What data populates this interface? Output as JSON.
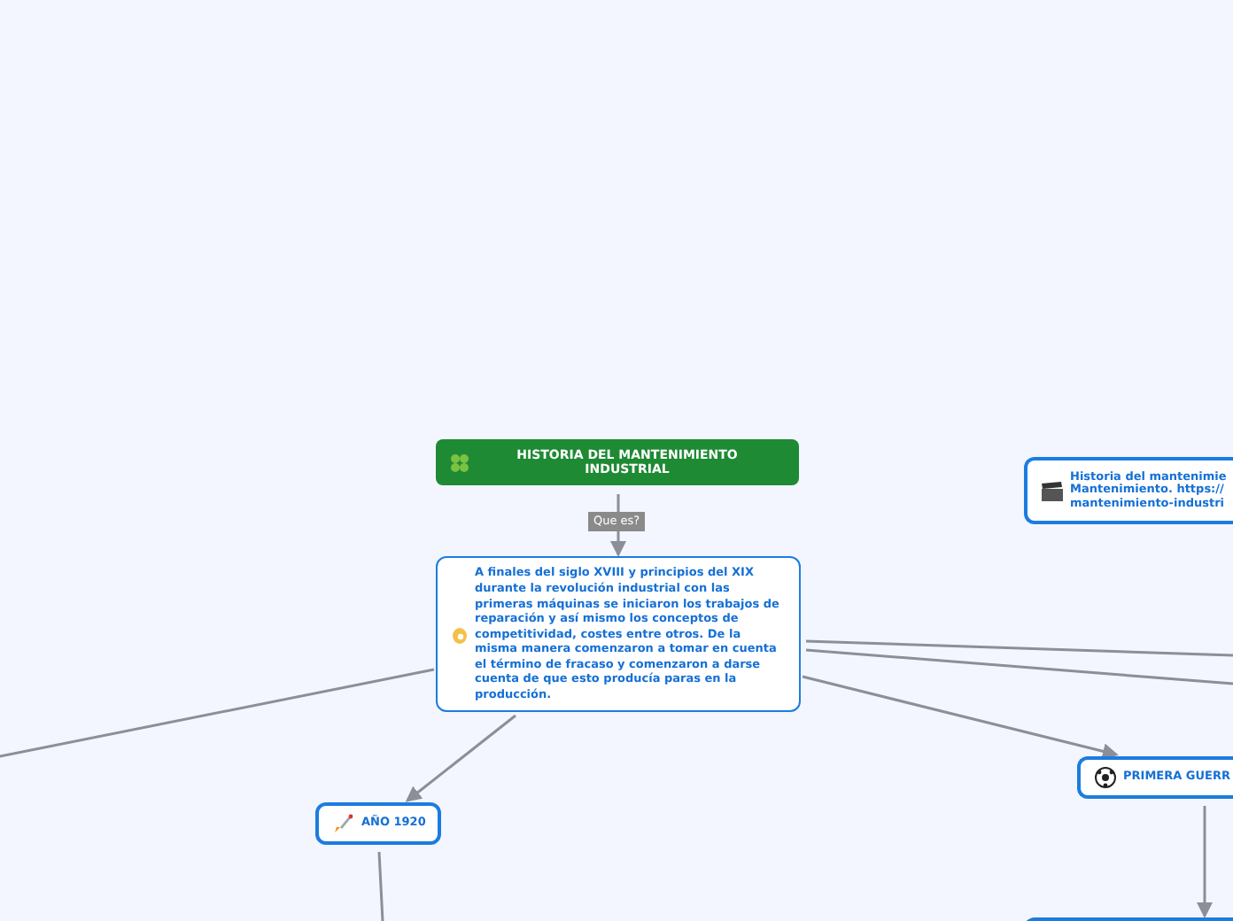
{
  "root": {
    "title": "HISTORIA DEL MANTENIMIENTO INDUSTRIAL"
  },
  "connector_label": "Que es?",
  "main_topic": {
    "text": "A finales del siglo XVIII y principios del XIX durante la revolución industrial con las primeras máquinas se iniciaron los trabajos de reparación y así mismo los conceptos de competitividad, costes entre otros. De la misma manera comenzaron a tomar en cuenta el término de fracaso y comenzaron a darse cuenta de que esto producía paras en la producción."
  },
  "topics": [
    {
      "kind": "video",
      "lines": [
        "Historia del mantenimie",
        "Mantenimiento. https://",
        "mantenimiento-industri"
      ]
    },
    {
      "kind": "rocket",
      "lines": [
        "AÑO 1920"
      ]
    },
    {
      "kind": "ball",
      "lines": [
        "PRIMERA GUERR"
      ]
    }
  ]
}
